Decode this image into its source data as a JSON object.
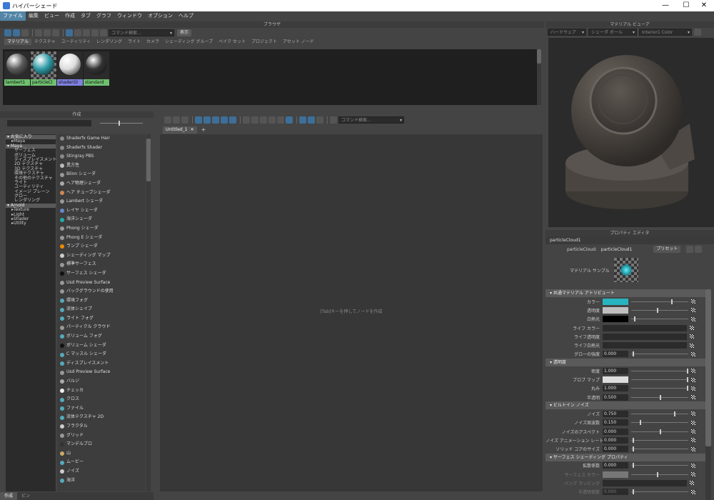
{
  "window": {
    "title": "ハイパーシェード",
    "min": "—",
    "max": "☐",
    "close": "✕"
  },
  "menu": [
    "ファイル",
    "編集",
    "ビュー",
    "作成",
    "タブ",
    "グラフ",
    "ウィンドウ",
    "オプション",
    "ヘルプ"
  ],
  "browser": {
    "title": "ブラウザ",
    "search_placeholder": "コマンド検索...",
    "show_button": "表示",
    "tabs": [
      "マテリアル",
      "テクスチャ",
      "ユーティリティ",
      "レンダリング",
      "ライト",
      "カメラ",
      "シェーディング グループ",
      "ベイク セット",
      "プロジェクト",
      "アセット ノード"
    ],
    "materials": [
      {
        "label": "lambert1",
        "color": "#5a5a5a"
      },
      {
        "label": "particleCl",
        "color": "#2e9aa6"
      },
      {
        "label": "shaderGl",
        "color": "#dddddd"
      },
      {
        "label": "standard",
        "color": "#333333"
      }
    ]
  },
  "create": {
    "title": "作成",
    "tree": [
      {
        "label": "お気に入り",
        "grp": true
      },
      {
        "label": "Maya",
        "arrow": true
      },
      {
        "label": "Maya",
        "grp": true
      },
      {
        "label": "サーフェス"
      },
      {
        "label": "ボリューム"
      },
      {
        "label": "ディスプレイスメント"
      },
      {
        "label": "2D テクスチャ"
      },
      {
        "label": "3D テクスチャ"
      },
      {
        "label": "環境テクスチャ"
      },
      {
        "label": "その他のテクスチャ"
      },
      {
        "label": "ライト"
      },
      {
        "label": "ユーティリティ"
      },
      {
        "label": "イメージ プレーン"
      },
      {
        "label": "グロー"
      },
      {
        "label": "レンダリング"
      },
      {
        "label": "Arnold",
        "grp": true
      },
      {
        "label": "Texture",
        "arrow": true
      },
      {
        "label": "Light",
        "arrow": true
      },
      {
        "label": "Shader",
        "arrow": true
      },
      {
        "label": "Utility",
        "arrow": true
      }
    ],
    "nodes": [
      "Shaderfx Game Hair",
      "Shaderfx Shader",
      "Stingray PBS",
      "異方性",
      "Blinn シェーダ",
      "ヘア物理シェーダ",
      "ヘア チューブシェーダ",
      "Lambert シェーダ",
      "レイヤ シェーダ",
      "海洋シェーダ",
      "Phong シェーダ",
      "Phong E シェーダ",
      "ランプ シェーダ",
      "シェーディング マップ",
      "標準サーフェス",
      "サーフェス シェーダ",
      "Usd Preview Surface",
      "バックグラウンドの使用",
      "環境フォグ",
      "流体シェイプ",
      "ライト フォグ",
      "パーティクル クラウド",
      "ボリューム フォグ",
      "ボリューム シェーダ",
      "C マッスル シェーダ",
      "ディスプレイスメント",
      "Usd Preview Surface",
      "バルジ",
      "チェッカ",
      "クロス",
      "ファイル",
      "流体テクスチャ 2D",
      "フラクタル",
      "グリッド",
      "マンデルブロ",
      "山",
      "ムービー",
      "ノイズ",
      "海洋"
    ],
    "bottom_tabs": [
      "作成",
      "ビン"
    ]
  },
  "graph": {
    "search_placeholder": "コマンド検索...",
    "tab": "Untitled_1",
    "tab_close": "✕",
    "add_tab": "+",
    "hint": "[Tab]キーを押してノードを作成"
  },
  "viewer": {
    "title": "マテリアル ビューア",
    "renderer": "ハードウェア",
    "shape": "シェーダ ボール",
    "env": "Interior1 Color"
  },
  "editor": {
    "title": "プロパティ エディタ",
    "node": "particleCloud1",
    "node_label": "particleCloud:",
    "node_value": "particleCloud1",
    "preset": "プリセット",
    "sample_label": "マテリアル サンプル",
    "sections": [
      {
        "title": "共通マテリアル アトリビュート",
        "attrs": [
          {
            "label": "カラー",
            "swatch": "#27b4c0",
            "knob": 0.7
          },
          {
            "label": "透明度",
            "swatch": "#bfbfbf",
            "knob": 0.45
          },
          {
            "label": "白熱光",
            "swatch": "#000000",
            "knob": 0.05
          },
          {
            "label": "ライフ カラー",
            "empty": true
          },
          {
            "label": "ライフ透明度",
            "empty": true
          },
          {
            "label": "ライフ白熱光",
            "empty": true
          },
          {
            "label": "グローの強度",
            "value": "0.000",
            "knob": 0.02
          }
        ]
      },
      {
        "title": "透明度",
        "attrs": [
          {
            "label": "密度",
            "value": "1.000",
            "knob": 0.98
          },
          {
            "label": "ブロブ マップ",
            "swatch": "#dddddd",
            "knob": 0.98
          },
          {
            "label": "丸み",
            "value": "1.000",
            "knob": 0.98
          },
          {
            "label": "半透明",
            "value": "0.500",
            "knob": 0.5
          }
        ]
      },
      {
        "title": "ビルトイン ノイズ",
        "attrs": [
          {
            "label": "ノイズ",
            "value": "0.750",
            "knob": 0.75
          },
          {
            "label": "ノイズ周波数",
            "value": "0.150",
            "knob": 0.15
          },
          {
            "label": "ノイズのアスペクト",
            "value": "0.000",
            "knob": 0.5
          },
          {
            "label": "ノイズ アニメーション レート",
            "value": "0.000",
            "knob": 0.02
          },
          {
            "label": "ソリッド コアのサイズ",
            "value": "0.000",
            "knob": 0.02
          }
        ]
      },
      {
        "title": "サーフェス シェーディング プロパティ",
        "attrs": [
          {
            "label": "拡散係数",
            "value": "0.000",
            "knob": 0.02
          },
          {
            "label": "サーフェス カラー",
            "swatch": "#777777",
            "knob": 0.45,
            "dim": true
          },
          {
            "label": "バンプ マッピング",
            "empty": true,
            "dim": true
          },
          {
            "label": "半透明係数",
            "value": "0.000",
            "knob": 0.02,
            "dim": true
          }
        ]
      }
    ]
  }
}
